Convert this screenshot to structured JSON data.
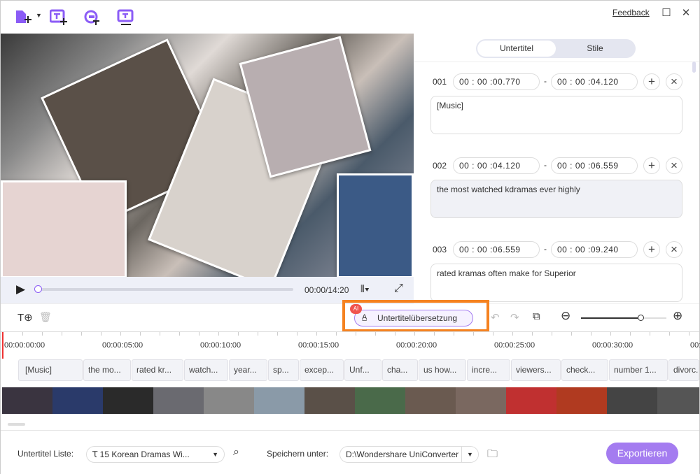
{
  "toolbar": {
    "icons": [
      "add-file-icon",
      "add-subtitle-icon",
      "auto-subtitle-icon",
      "text-to-subtitle-icon"
    ],
    "feedback": "Feedback"
  },
  "player": {
    "time": "00:00/14:20",
    "progress": 0
  },
  "tabs": {
    "subtitle": "Untertitel",
    "styles": "Stile"
  },
  "entries": [
    {
      "num": "001",
      "start": "00 : 00 :00.770",
      "end": "00 : 00 :04.120",
      "text": "[Music]"
    },
    {
      "num": "002",
      "start": "00 : 00 :04.120",
      "end": "00 : 00 :06.559",
      "text": "the most watched kdramas ever highly"
    },
    {
      "num": "003",
      "start": "00 : 00 :06.559",
      "end": "00 : 00 :09.240",
      "text": "rated kramas often make for Superior"
    }
  ],
  "timeline": {
    "ai_badge": "AI",
    "translate": "Untertitelübersetzung",
    "zoom_level": 0.7,
    "ruler": [
      "00:00:00:00",
      "00:00:05:00",
      "00:00:10:00",
      "00:00:15:00",
      "00:00:20:00",
      "00:00:25:00",
      "00:00:30:00",
      "00:"
    ],
    "clips": [
      "[Music]",
      "the mo...",
      "rated kr...",
      "watch...",
      "year...",
      "sp...",
      "excep...",
      "Unf...",
      "cha...",
      "us how...",
      "incre...",
      "viewers...",
      "check...",
      "number 1...",
      "divorc..."
    ]
  },
  "bottom": {
    "list_label": "Untertitel Liste:",
    "list_value": "15 Korean Dramas Wi...",
    "save_label": "Speichern unter:",
    "save_value": "D:\\Wondershare UniConverter",
    "export": "Exportieren"
  },
  "colors": {
    "accent": "#8b5cf6",
    "export": "#a47cf0",
    "highlight": "#f58220"
  }
}
